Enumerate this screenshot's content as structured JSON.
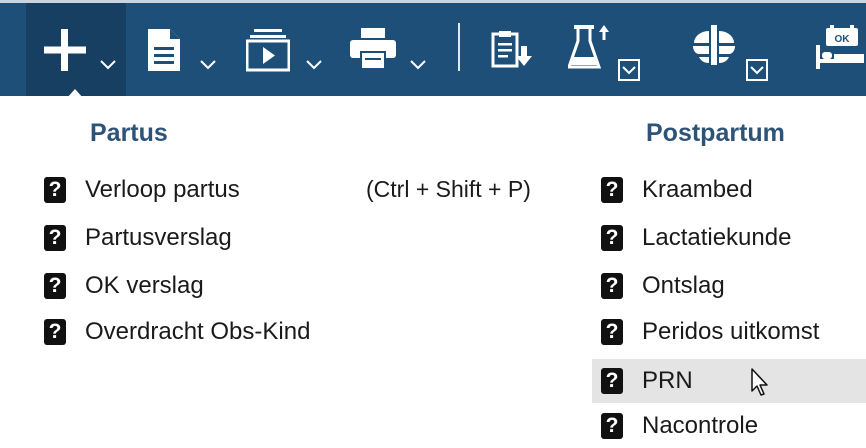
{
  "toolbar": {
    "background": "#1e4f78",
    "buttons": [
      {
        "icon": "plus-icon",
        "has_dropdown": true,
        "active": true
      },
      {
        "icon": "document-icon",
        "has_dropdown": true
      },
      {
        "icon": "media-player-icon",
        "has_dropdown": true
      },
      {
        "icon": "printer-icon",
        "has_dropdown": true
      },
      {
        "icon": "clipboard-download-icon",
        "has_dropdown": false
      },
      {
        "icon": "flask-icon",
        "has_dropdown": true
      },
      {
        "icon": "lungs-icon",
        "has_dropdown": true
      },
      {
        "icon": "bed-ok-icon",
        "has_dropdown": false
      }
    ]
  },
  "menu": {
    "columns": [
      {
        "heading": "Partus",
        "items": [
          {
            "label": "Verloop partus",
            "shortcut": "(Ctrl + Shift + P)",
            "icon": "help-icon"
          },
          {
            "label": "Partusverslag",
            "icon": "help-icon"
          },
          {
            "label": "OK verslag",
            "icon": "help-icon"
          },
          {
            "label": "Overdracht Obs-Kind",
            "icon": "help-icon"
          }
        ]
      },
      {
        "heading": "Postpartum",
        "items": [
          {
            "label": "Kraambed",
            "icon": "help-icon"
          },
          {
            "label": "Lactatiekunde",
            "icon": "help-icon"
          },
          {
            "label": "Ontslag",
            "icon": "help-icon"
          },
          {
            "label": "Peridos uitkomst",
            "icon": "help-icon"
          },
          {
            "label": "PRN",
            "icon": "help-icon",
            "highlighted": true
          },
          {
            "label": "Nacontrole",
            "icon": "help-icon"
          }
        ]
      }
    ],
    "item_icon_glyph": "?",
    "heading_color": "#2d5478",
    "highlight_color": "#e4e4e4"
  }
}
